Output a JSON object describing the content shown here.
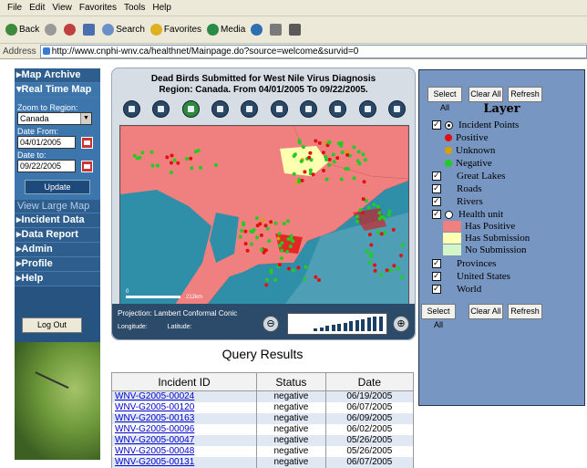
{
  "browser": {
    "menu": [
      "File",
      "Edit",
      "View",
      "Favorites",
      "Tools",
      "Help"
    ],
    "toolbar": [
      "Back",
      "Search",
      "Favorites",
      "Media"
    ],
    "address_label": "Address",
    "url": "http://www.cnphi-wnv.ca/healthnet/Mainpage.do?source=welcome&survid=0"
  },
  "sidebar": {
    "nav_top": [
      {
        "label": "Map Archive"
      },
      {
        "label": "Real Time Map"
      }
    ],
    "zoom_label": "Zoom to Region:",
    "region_value": "Canada",
    "date_from_label": "Date From:",
    "date_from": "04/01/2005",
    "date_to_label": "Date to:",
    "date_to": "09/22/2005",
    "update_label": "Update",
    "view_large": "View Large Map",
    "nav_bottom": [
      {
        "label": "Incident Data"
      },
      {
        "label": "Data Report"
      },
      {
        "label": "Admin"
      },
      {
        "label": "Profile"
      },
      {
        "label": "Help"
      }
    ],
    "logout_label": "Log Out"
  },
  "map": {
    "title_line1": "Dead Birds Submitted for West Nile Virus Diagnosis",
    "title_line2": "Region: Canada. From 04/01/2005 To 09/22/2005.",
    "tools": [
      "full-extent-icon",
      "zoom-in-icon",
      "refresh-icon",
      "measure-icon",
      "pan-icon",
      "identify-icon",
      "print-icon",
      "select-icon",
      "layers-icon",
      "save-icon"
    ],
    "scale_left": "0",
    "scale_right": "212km",
    "projection": "Projection: Lambert Conformal Conic",
    "longitude_label": "Longitude:",
    "latitude_label": "Latitude:"
  },
  "query": {
    "title": "Query Results",
    "headers": [
      "Incident ID",
      "Status",
      "Date"
    ],
    "rows": [
      {
        "id": "WNV-G2005-00024",
        "status": "negative",
        "date": "06/19/2005"
      },
      {
        "id": "WNV-G2005-00120",
        "status": "negative",
        "date": "06/07/2005"
      },
      {
        "id": "WNV-G2005-00163",
        "status": "negative",
        "date": "06/09/2005"
      },
      {
        "id": "WNV-G2005-00096",
        "status": "negative",
        "date": "06/02/2005"
      },
      {
        "id": "WNV-G2005-00047",
        "status": "negative",
        "date": "05/26/2005"
      },
      {
        "id": "WNV-G2005-00048",
        "status": "negative",
        "date": "05/26/2005"
      },
      {
        "id": "WNV-G2005-00131",
        "status": "negative",
        "date": "06/07/2005"
      }
    ]
  },
  "layers": {
    "select_all": "Select All",
    "clear_all": "Clear All",
    "refresh": "Refresh",
    "heading": "Layer",
    "incident_points": "Incident Points",
    "positive": "Positive",
    "unknown": "Unknown",
    "negative": "Negative",
    "great_lakes": "Great Lakes",
    "roads": "Roads",
    "rivers": "Rivers",
    "health_unit": "Health unit",
    "has_positive": "Has Positive",
    "has_submission": "Has Submission",
    "no_submission": "No Submission",
    "provinces": "Provinces",
    "united_states": "United States",
    "world": "World",
    "colors": {
      "positive": "#e01010",
      "unknown": "#d8a000",
      "negative": "#22cc22",
      "has_positive": "#f08080",
      "has_submission": "#ffffb0",
      "no_submission": "#d4f5c8"
    }
  }
}
